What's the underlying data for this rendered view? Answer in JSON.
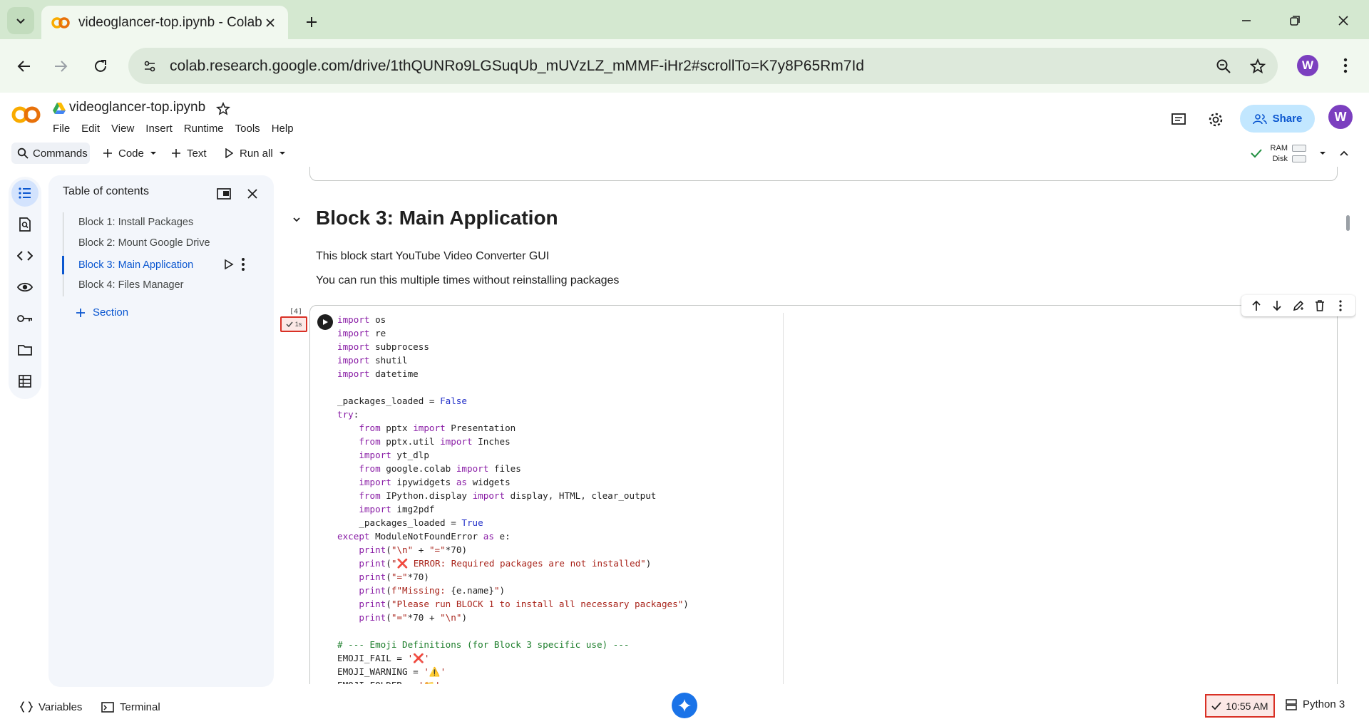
{
  "browser": {
    "tab_title": "videoglancer-top.ipynb - Colab",
    "url": "colab.research.google.com/drive/1thQUNRo9LGSuqUb_mUVzLZ_mMMF-iHr2#scrollTo=K7y8P65Rm7Id",
    "profile_initial": "W"
  },
  "colab": {
    "notebook_title": "videoglancer-top.ipynb",
    "menu": [
      "File",
      "Edit",
      "View",
      "Insert",
      "Runtime",
      "Tools",
      "Help"
    ],
    "share_label": "Share",
    "user_initial": "W"
  },
  "toolbar": {
    "commands_label": "Commands",
    "code_label": "Code",
    "text_label": "Text",
    "run_all_label": "Run all",
    "ram_label": "RAM",
    "disk_label": "Disk"
  },
  "toc": {
    "title": "Table of contents",
    "items": [
      {
        "label": "Block 1: Install Packages",
        "active": false
      },
      {
        "label": "Block 2: Mount Google Drive",
        "active": false
      },
      {
        "label": "Block 3: Main Application",
        "active": true
      },
      {
        "label": "Block 4: Files Manager",
        "active": false
      }
    ],
    "add_section_label": "Section"
  },
  "notebook": {
    "heading": "Block 3: Main Application",
    "paragraphs": [
      "This block start YouTube Video Converter GUI",
      "You can run this multiple times without reinstalling packages"
    ],
    "exec_count": "[4]",
    "exec_duration": "1s"
  },
  "code_lines": [
    [
      [
        "kw",
        "import"
      ],
      [
        "tx",
        " os"
      ]
    ],
    [
      [
        "kw",
        "import"
      ],
      [
        "tx",
        " re"
      ]
    ],
    [
      [
        "kw",
        "import"
      ],
      [
        "tx",
        " subprocess"
      ]
    ],
    [
      [
        "kw",
        "import"
      ],
      [
        "tx",
        " shutil"
      ]
    ],
    [
      [
        "kw",
        "import"
      ],
      [
        "tx",
        " datetime"
      ]
    ],
    [],
    [
      [
        "tx",
        "_packages_loaded = "
      ],
      [
        "bl",
        "False"
      ]
    ],
    [
      [
        "kw",
        "try"
      ],
      [
        "tx",
        ":"
      ]
    ],
    [
      [
        "tx",
        "    "
      ],
      [
        "kw",
        "from"
      ],
      [
        "tx",
        " pptx "
      ],
      [
        "kw",
        "import"
      ],
      [
        "tx",
        " Presentation"
      ]
    ],
    [
      [
        "tx",
        "    "
      ],
      [
        "kw",
        "from"
      ],
      [
        "tx",
        " pptx.util "
      ],
      [
        "kw",
        "import"
      ],
      [
        "tx",
        " Inches"
      ]
    ],
    [
      [
        "tx",
        "    "
      ],
      [
        "kw",
        "import"
      ],
      [
        "tx",
        " yt_dlp"
      ]
    ],
    [
      [
        "tx",
        "    "
      ],
      [
        "kw",
        "from"
      ],
      [
        "tx",
        " google.colab "
      ],
      [
        "kw",
        "import"
      ],
      [
        "tx",
        " files"
      ]
    ],
    [
      [
        "tx",
        "    "
      ],
      [
        "kw",
        "import"
      ],
      [
        "tx",
        " ipywidgets "
      ],
      [
        "kw",
        "as"
      ],
      [
        "tx",
        " widgets"
      ]
    ],
    [
      [
        "tx",
        "    "
      ],
      [
        "kw",
        "from"
      ],
      [
        "tx",
        " IPython.display "
      ],
      [
        "kw",
        "import"
      ],
      [
        "tx",
        " display, HTML, clear_output"
      ]
    ],
    [
      [
        "tx",
        "    "
      ],
      [
        "kw",
        "import"
      ],
      [
        "tx",
        " img2pdf"
      ]
    ],
    [
      [
        "tx",
        "    _packages_loaded = "
      ],
      [
        "bl",
        "True"
      ]
    ],
    [
      [
        "kw",
        "except"
      ],
      [
        "tx",
        " ModuleNotFoundError "
      ],
      [
        "kw",
        "as"
      ],
      [
        "tx",
        " e:"
      ]
    ],
    [
      [
        "tx",
        "    "
      ],
      [
        "kw",
        "print"
      ],
      [
        "tx",
        "("
      ],
      [
        "st",
        "\"\\n\""
      ],
      [
        "tx",
        " + "
      ],
      [
        "st",
        "\"=\""
      ],
      [
        "tx",
        "*70)"
      ]
    ],
    [
      [
        "tx",
        "    "
      ],
      [
        "kw",
        "print"
      ],
      [
        "tx",
        "("
      ],
      [
        "st",
        "\"❌ ERROR: Required packages are not installed\""
      ],
      [
        "tx",
        ")"
      ]
    ],
    [
      [
        "tx",
        "    "
      ],
      [
        "kw",
        "print"
      ],
      [
        "tx",
        "("
      ],
      [
        "st",
        "\"=\""
      ],
      [
        "tx",
        "*70)"
      ]
    ],
    [
      [
        "tx",
        "    "
      ],
      [
        "kw",
        "print"
      ],
      [
        "tx",
        "("
      ],
      [
        "st",
        "f\"Missing: "
      ],
      [
        "tx",
        "{e.name}"
      ],
      [
        "st",
        "\""
      ],
      [
        "tx",
        ")"
      ]
    ],
    [
      [
        "tx",
        "    "
      ],
      [
        "kw",
        "print"
      ],
      [
        "tx",
        "("
      ],
      [
        "st",
        "\"Please run BLOCK 1 to install all necessary packages\""
      ],
      [
        "tx",
        ")"
      ]
    ],
    [
      [
        "tx",
        "    "
      ],
      [
        "kw",
        "print"
      ],
      [
        "tx",
        "("
      ],
      [
        "st",
        "\"=\""
      ],
      [
        "tx",
        "*70 + "
      ],
      [
        "st",
        "\"\\n\""
      ],
      [
        "tx",
        ")"
      ]
    ],
    [],
    [
      [
        "cm",
        "# --- Emoji Definitions (for Block 3 specific use) ---"
      ]
    ],
    [
      [
        "tx",
        "EMOJI_FAIL = "
      ],
      [
        "st",
        "'❌'"
      ]
    ],
    [
      [
        "tx",
        "EMOJI_WARNING = "
      ],
      [
        "st",
        "'⚠️'"
      ]
    ],
    [
      [
        "tx",
        "EMOJI_FOLDER = "
      ],
      [
        "st",
        "'📁'"
      ]
    ]
  ],
  "statusbar": {
    "variables_label": "Variables",
    "terminal_label": "Terminal",
    "time": "10:55 AM",
    "kernel": "Python 3"
  },
  "colors": {
    "accent": "#0b57d0",
    "error_border": "#d93025",
    "tab_strip": "#d4e8d0"
  }
}
